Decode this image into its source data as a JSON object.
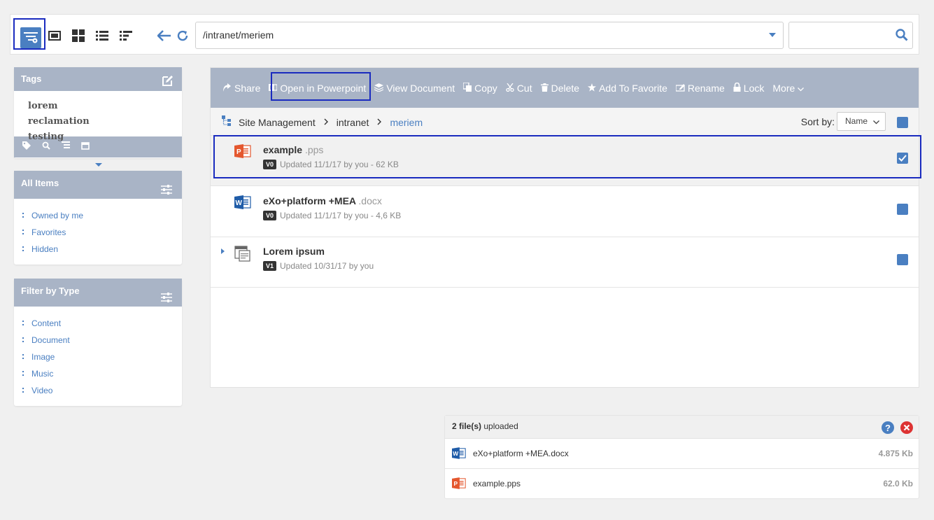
{
  "toolbar": {
    "views": [
      "admin-view-icon",
      "cover-flow-icon",
      "thumbnails-icon",
      "list-icon",
      "tree-icon"
    ],
    "address": "/intranet/meriem",
    "search_placeholder": ""
  },
  "tags_panel": {
    "title": "Tags",
    "tags": [
      "lorem",
      "reclamation",
      "testing"
    ]
  },
  "all_items_panel": {
    "title": "All Items",
    "items": [
      "Owned by me",
      "Favorites",
      "Hidden"
    ]
  },
  "filter_panel": {
    "title": "Filter by Type",
    "items": [
      "Content",
      "Document",
      "Image",
      "Music",
      "Video"
    ]
  },
  "actions": [
    {
      "label": "Share",
      "icon": "share-icon"
    },
    {
      "label": "Open in Powerpoint",
      "icon": "powerpoint-icon"
    },
    {
      "label": "View Document",
      "icon": "view-document-icon"
    },
    {
      "label": "Copy",
      "icon": "copy-icon"
    },
    {
      "label": "Cut",
      "icon": "cut-icon"
    },
    {
      "label": "Delete",
      "icon": "trash-icon"
    },
    {
      "label": "Add To Favorite",
      "icon": "star-icon"
    },
    {
      "label": "Rename",
      "icon": "rename-icon"
    },
    {
      "label": "Lock",
      "icon": "lock-icon"
    },
    {
      "label": "More",
      "icon": "chevron-down-icon"
    }
  ],
  "breadcrumb": {
    "items": [
      "Site Management",
      "intranet",
      "meriem"
    ]
  },
  "sort": {
    "label": "Sort by:",
    "value": "Name"
  },
  "files": [
    {
      "name": "example",
      "ext": ".pps",
      "version": "V0",
      "meta": "Updated 11/1/17 by you - 62 KB",
      "type": "powerpoint"
    },
    {
      "name": "eXo+platform +MEA",
      "ext": ".docx",
      "version": "V0",
      "meta": "Updated 11/1/17 by you - 4,6 KB",
      "type": "word"
    },
    {
      "name": "Lorem ipsum",
      "ext": "",
      "version": "V1",
      "meta": "Updated 10/31/17 by you",
      "type": "content"
    }
  ],
  "upload": {
    "count": "2 file(s)",
    "status": "uploaded",
    "files": [
      {
        "name": "eXo+platform +MEA.docx",
        "size": "4.875 Kb",
        "type": "word"
      },
      {
        "name": "example.pps",
        "size": "62.0 Kb",
        "type": "powerpoint"
      }
    ]
  },
  "colors": {
    "accent": "#4a7fc1",
    "header_bg": "#a9b4c6",
    "selection_border": "#1a2bbf",
    "powerpoint": "#e4572e",
    "word": "#1f5ca8",
    "close": "#d33"
  }
}
